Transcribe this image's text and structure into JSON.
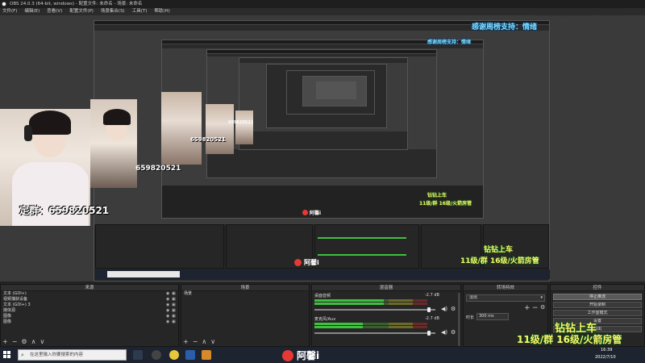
{
  "window": {
    "title": "OBS 24.0.3 (64-bit, windows) - 配置文件: 未命名 - 场景: 未命名"
  },
  "menu": [
    "文件(F)",
    "编辑(E)",
    "查看(V)",
    "配置文件(P)",
    "场景集合(S)",
    "工具(T)",
    "帮助(H)"
  ],
  "overlay": {
    "thanks_text": "感谢周榜支持：情绪",
    "group_text": "定群：659820521",
    "group_number": "659820521",
    "promo_line1": "钻钻上车",
    "promo_line2": "11级/群 16级/火箭房管"
  },
  "streamer": {
    "name": "阿馨i"
  },
  "docks": {
    "sources": {
      "title": "来源",
      "items": [
        "文本 (GDI+)",
        "视频捕获设备",
        "文本 (GDI+) 3",
        "媒体源",
        "图像",
        "图像"
      ]
    },
    "scenes": {
      "title": "场景",
      "items": [
        "场景"
      ]
    },
    "mixer": {
      "title": "混音器",
      "tracks": [
        {
          "name": "桌面音频",
          "db": "-2.7 dB"
        },
        {
          "name": "麦克风/Aux",
          "db": "-2.7 dB"
        }
      ]
    },
    "transitions": {
      "title": "转场特效",
      "selected": "淡出",
      "duration_label": "时长",
      "duration_value": "300 ms"
    },
    "controls": {
      "title": "控件",
      "buttons": [
        "停止推流",
        "开始录制",
        "工作室模式",
        "设置",
        "退出"
      ]
    }
  },
  "taskbar": {
    "search_placeholder": "在这里输入你要搜索的内容",
    "time": "16:39",
    "date": "2022/7/10"
  },
  "colors": {
    "overlay_blue": "#7fdcff",
    "overlay_yellow": "#fff36a",
    "meter_green": "#3fbf3f",
    "taskbar": "#1d2430"
  }
}
